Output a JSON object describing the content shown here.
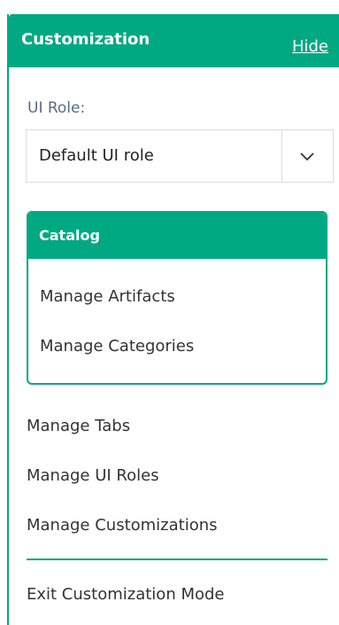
{
  "panel": {
    "title": "Customization",
    "hide_label": "Hide"
  },
  "ui_role": {
    "label": "UI Role:",
    "selected": "Default UI role"
  },
  "catalog": {
    "title": "Catalog",
    "items": [
      {
        "label": "Manage Artifacts"
      },
      {
        "label": "Manage Categories"
      }
    ]
  },
  "menu": {
    "items": [
      {
        "label": "Manage Tabs"
      },
      {
        "label": "Manage UI Roles"
      },
      {
        "label": "Manage Customizations"
      }
    ],
    "exit_label": "Exit Customization Mode"
  },
  "colors": {
    "accent": "#01a982",
    "text": "#333333",
    "muted_label": "#5a6a87"
  },
  "icons": {
    "select_toggle": "chevron-down-icon"
  }
}
